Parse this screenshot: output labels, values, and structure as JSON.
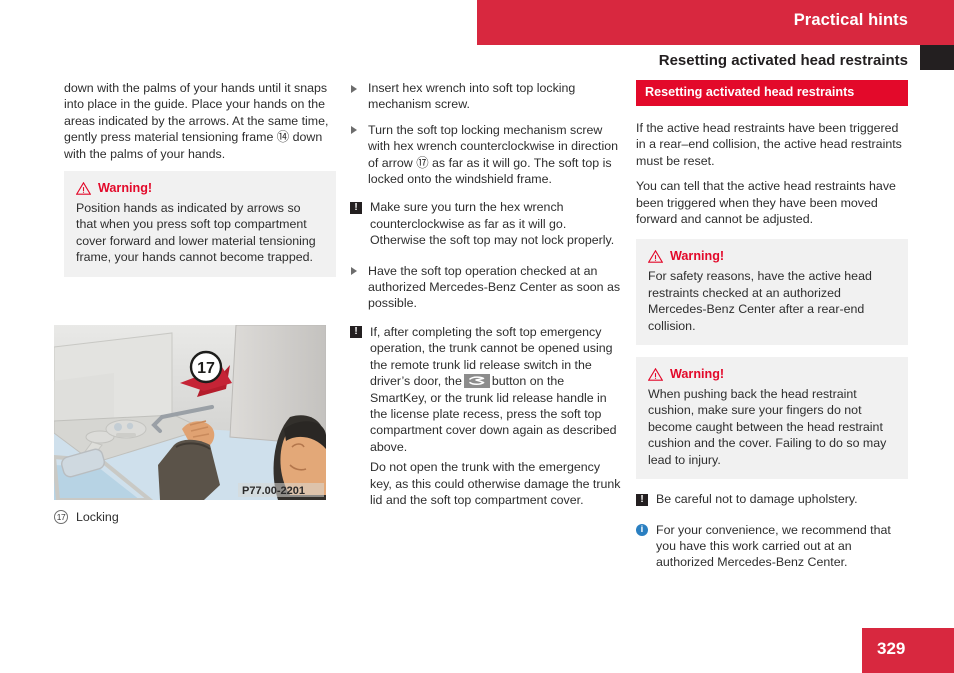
{
  "header": {
    "title": "Practical hints",
    "section_title": "Resetting activated head restraints",
    "bar_color": "#d8283f",
    "tab_color": "#231f20"
  },
  "footer": {
    "page_number": "329",
    "box_color": "#d8283f"
  },
  "icons": {
    "warning_triangle": "warning-triangle-icon",
    "caution_square": "caution-exclamation-icon",
    "info_circle": "info-circle-icon",
    "bullet_arrow": "bullet-arrow-icon",
    "trunk_release_button": "trunk-release-button-icon",
    "caution_glyph": "!",
    "info_glyph": "i"
  },
  "colors": {
    "warning_red": "#e3092a",
    "header_red": "#d8283f",
    "warning_box_bg": "#f1f1f1",
    "info_blue": "#2a7fc1",
    "inline_button_gray": "#8d8d8d"
  },
  "left_column": {
    "continued_paragraph": "down with the palms of your hands until it snaps into place in the guide. Place your hands on the areas indicated by the arrows. At the same time, gently press material tensioning frame ⑭ down with the palms of your hands.",
    "warning": {
      "title": "Warning!",
      "text": "Position hands as indicated by arrows so that when you press soft top compartment cover forward and lower material tensioning frame, your hands cannot become trapped."
    },
    "figure": {
      "image_code": "P77.00-2201",
      "callout_number": "17",
      "caption_number": "⑰",
      "caption_text": "Locking"
    }
  },
  "middle_column": {
    "steps": [
      "Insert hex wrench into soft top locking mechanism screw.",
      "Turn the soft top locking mechanism screw with hex wrench counterclockwise in direction of arrow ⑰ as far as it will go. The soft top is locked onto the windshield frame."
    ],
    "caution_1": "Make sure you turn the hex wrench counterclockwise as far as it will go. Otherwise the soft top may not lock properly.",
    "step_3": "Have the soft top operation checked at an authorized Mercedes-Benz Center as soon as possible.",
    "caution_2_part1": "If, after completing the soft top emergency operation, the trunk cannot be opened using the remote trunk lid release switch in the driver’s door, the",
    "caution_2_part2": "button on the SmartKey, or the trunk lid release handle in the license plate recess, press the soft top compartment cover down again as described above.",
    "caution_2_continued": "Do not open the trunk with the emergency key, as this could otherwise damage the trunk lid and the soft top compartment cover."
  },
  "right_column": {
    "red_heading": "Resetting activated head restraints",
    "intro_paragraph_1": "If the active head restraints have been triggered in a rear–end collision, the active head restraints must be reset.",
    "intro_paragraph_2": "You can tell that the active head restraints have been triggered when they have been moved forward and cannot be adjusted.",
    "warning_1": {
      "title": "Warning!",
      "text": "For safety reasons, have the active head restraints checked at an authorized Mercedes-Benz Center after a rear-end collision."
    },
    "warning_2": {
      "title": "Warning!",
      "text": "When pushing back the head restraint cushion, make sure your fingers do not become caught between the head restraint cushion and the cover. Failing to do so may lead to injury."
    },
    "caution_note": "Be careful not to damage upholstery.",
    "info_note": "For your convenience, we recommend that you have this work carried out at an authorized Mercedes-Benz Center."
  }
}
